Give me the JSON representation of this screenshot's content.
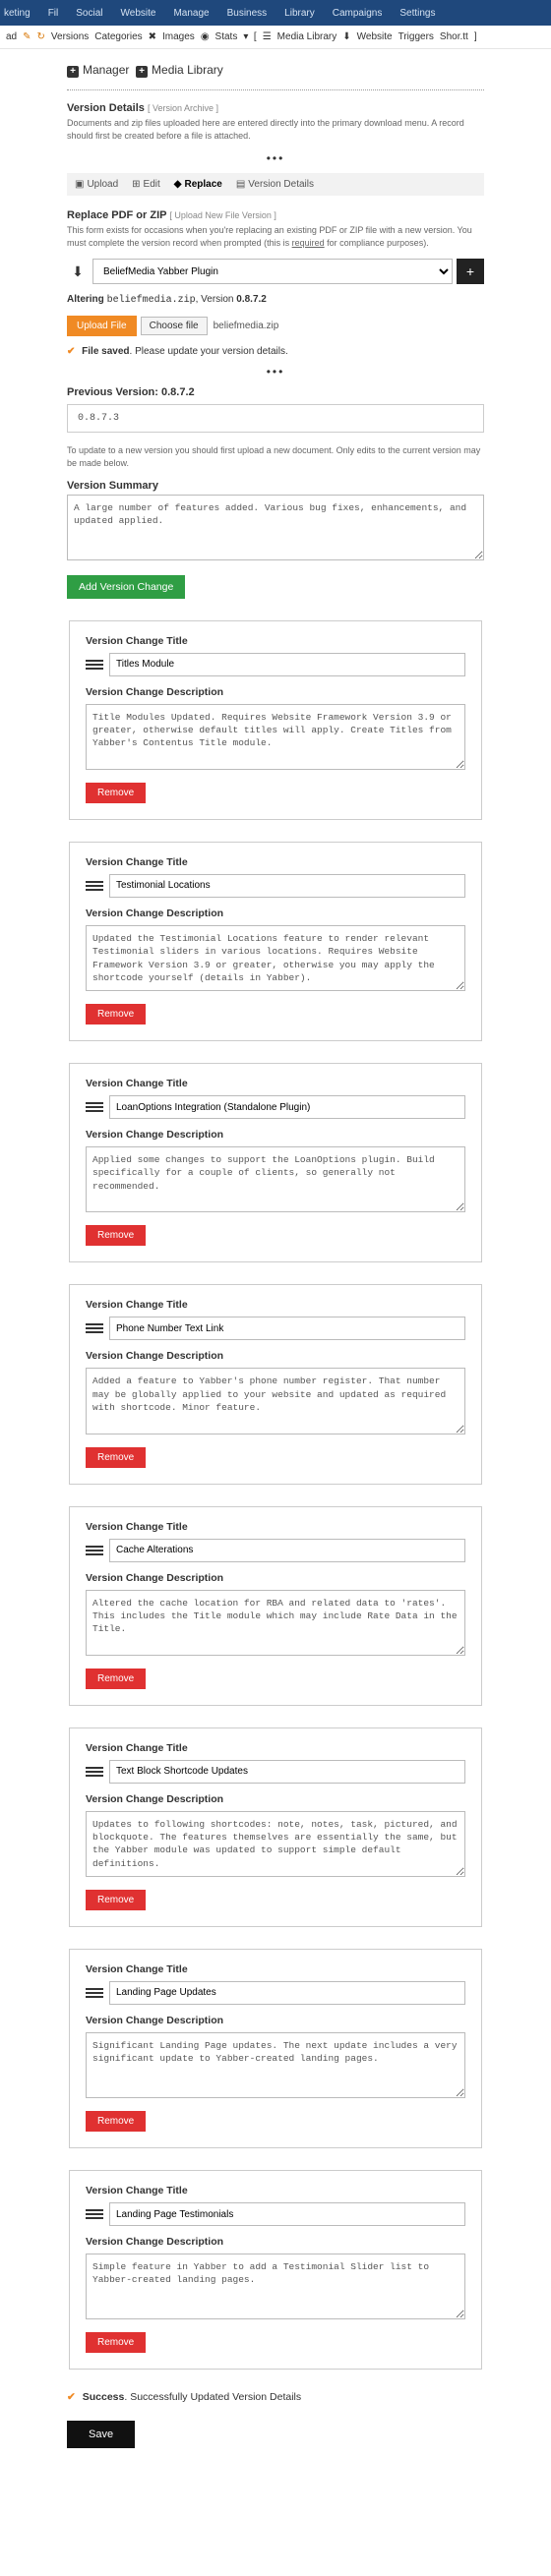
{
  "topnav": [
    "keting",
    "Fil",
    "Social",
    "Website",
    "Manage",
    "Business",
    "Library",
    "Campaigns",
    "Settings"
  ],
  "subnav": {
    "breadcrumb_left": "ad",
    "versions": "Versions",
    "categories": "Categories",
    "images": "Images",
    "stats": "Stats",
    "media_library": "Media Library",
    "website": "Website",
    "triggers": "Triggers",
    "shortt": "Shor.tt"
  },
  "crumbs": {
    "manager": "Manager",
    "media": "Media Library"
  },
  "version_details": {
    "title": "Version Details",
    "sub": "[ Version Archive ]",
    "desc": "Documents and zip files uploaded here are entered directly into the primary download menu. A record should first be created before a file is attached."
  },
  "tabs": {
    "upload": "Upload",
    "edit": "Edit",
    "replace": "Replace",
    "vdetails": "Version Details"
  },
  "replace": {
    "title": "Replace PDF or ZIP",
    "sub": "[ Upload New File Version ]",
    "desc_a": "This form exists for occasions when you're replacing an existing PDF or ZIP file with a new version. You must complete the version record when prompted (this is ",
    "desc_req": "required",
    "desc_b": " for compliance purposes)."
  },
  "plugin_select": "BeliefMedia Yabber Plugin",
  "altering": {
    "pre": "Altering ",
    "file": "beliefmedia.zip",
    "mid": ", Version ",
    "ver": "0.8.7.2"
  },
  "upload_btn": "Upload File",
  "choose_file": "Choose file",
  "chosen_file": "beliefmedia.zip",
  "saved_msg_bold": "File saved",
  "saved_msg_rest": ". Please update your version details.",
  "prev_version_label": "Previous Version: 0.8.7.2",
  "prev_version_value": "0.8.7.3",
  "update_note": "To update to a new version you should first upload a new document. Only edits to the current version may be made below.",
  "summary_label": "Version Summary",
  "summary_text": "A large number of features added. Various bug fixes, enhancements, and updated applied.",
  "add_change_btn": "Add Version Change",
  "card_labels": {
    "title": "Version Change Title",
    "desc": "Version Change Description"
  },
  "remove_btn": "Remove",
  "changes": [
    {
      "title": "Titles Module",
      "desc": "Title Modules Updated. Requires Website Framework Version 3.9 or greater, otherwise default titles will apply. Create Titles from Yabber's Contentus Title module."
    },
    {
      "title": "Testimonial Locations",
      "desc": "Updated the Testimonial Locations feature to render relevant Testimonial sliders in various locations. Requires Website Framework Version 3.9 or greater, otherwise you may apply the shortcode yourself (details in Yabber)."
    },
    {
      "title": "LoanOptions Integration (Standalone Plugin)",
      "desc": "Applied some changes to support the LoanOptions plugin. Build specifically for a couple of clients, so generally not recommended."
    },
    {
      "title": "Phone Number Text Link",
      "desc": "Added a feature to Yabber's phone number register. That number may be globally applied to your website and updated as required with shortcode. Minor feature."
    },
    {
      "title": "Cache Alterations",
      "desc": "Altered the cache location for RBA and related data to 'rates'. This includes the Title module which may include Rate Data in the Title."
    },
    {
      "title": "Text Block Shortcode Updates",
      "desc": "Updates to following shortcodes: note, notes, task, pictured, and blockquote. The features themselves are essentially the same, but the Yabber module was updated to support simple default definitions."
    },
    {
      "title": "Landing Page Updates",
      "desc": "Significant Landing Page updates. The next update includes a very significant update to Yabber-created landing pages."
    },
    {
      "title": "Landing Page Testimonials",
      "desc": "Simple feature in Yabber to add a Testimonial Slider list to Yabber-created landing pages."
    }
  ],
  "success": {
    "bold": "Success",
    "rest": ". Successfully Updated Version Details"
  },
  "save_btn": "Save"
}
